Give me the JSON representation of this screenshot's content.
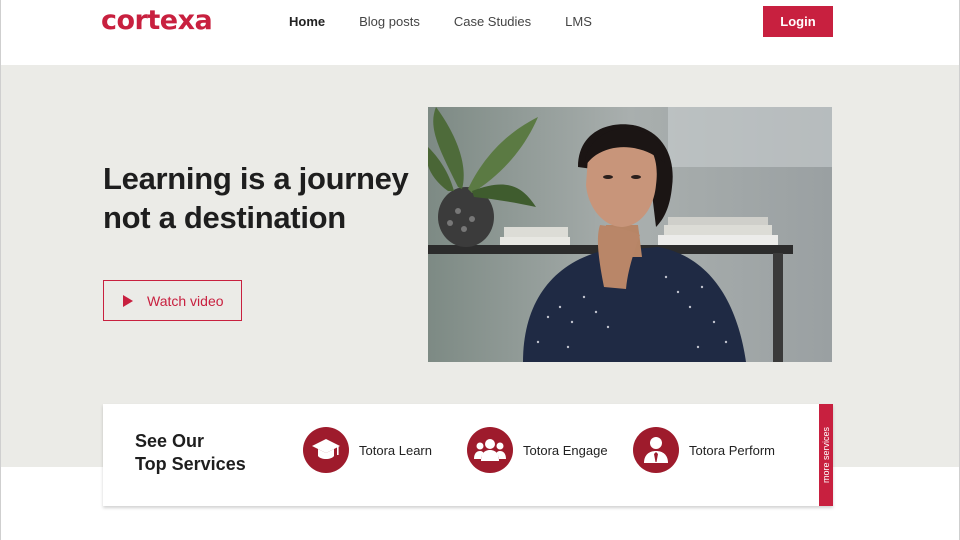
{
  "brand": {
    "logo_text": "cortexa",
    "accent": "#c8203f",
    "dark_accent": "#9e1b2c"
  },
  "nav": {
    "items": [
      {
        "label": "Home",
        "active": true
      },
      {
        "label": "Blog posts",
        "active": false
      },
      {
        "label": "Case Studies",
        "active": false
      },
      {
        "label": "LMS",
        "active": false
      }
    ],
    "login_label": "Login"
  },
  "hero": {
    "title_line1": "Learning is a journey",
    "title_line2": "not a destination",
    "watch_label": "Watch video",
    "watch_icon": "play-icon",
    "background": "#ebebe7"
  },
  "services": {
    "title_line1": "See Our",
    "title_line2": "Top Services",
    "items": [
      {
        "label": "Totora Learn",
        "icon": "graduation-cap-icon"
      },
      {
        "label": "Totora Engage",
        "icon": "group-icon"
      },
      {
        "label": "Totora Perform",
        "icon": "user-tie-icon"
      }
    ],
    "more_label": "more services"
  }
}
